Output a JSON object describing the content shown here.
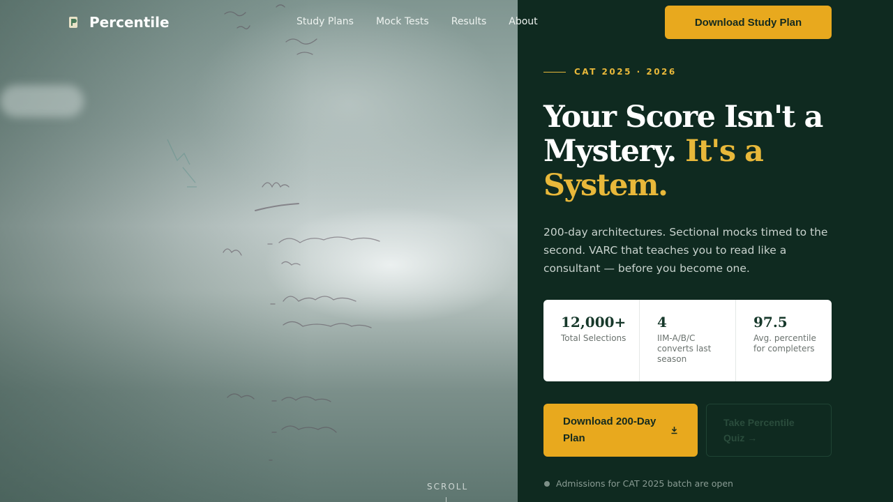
{
  "brand": {
    "name": "Percentile",
    "logo_icon": "percentile-logo-icon"
  },
  "nav": {
    "items": [
      "Study Plans",
      "Mock Tests",
      "Results",
      "About"
    ]
  },
  "header_cta": "Download Study Plan",
  "hero": {
    "eyebrow": "CAT 2025 · 2026",
    "headline_part1": "Your Score Isn't a Mystery. ",
    "headline_accent": "It's a System.",
    "subtext": "200-day architectures. Sectional mocks timed to the second. VARC that teaches you to read like a consultant — before you become one."
  },
  "stats": [
    {
      "value": "12,000+",
      "label": "Total Selections"
    },
    {
      "value": "4",
      "label": "IIM-A/B/C converts last season"
    },
    {
      "value": "97.5",
      "label": "Avg. percentile for completers"
    }
  ],
  "buttons": {
    "primary": "Download 200-Day Plan",
    "primary_icon": "download-icon",
    "secondary": "Take Percentile Quiz →"
  },
  "status_text": "Admissions for CAT 2025 batch are open",
  "scroll_label": "SCROLL",
  "colors": {
    "panel": "#0f2a20",
    "accent": "#e8a91e",
    "accent_text": "#e8b83a"
  }
}
